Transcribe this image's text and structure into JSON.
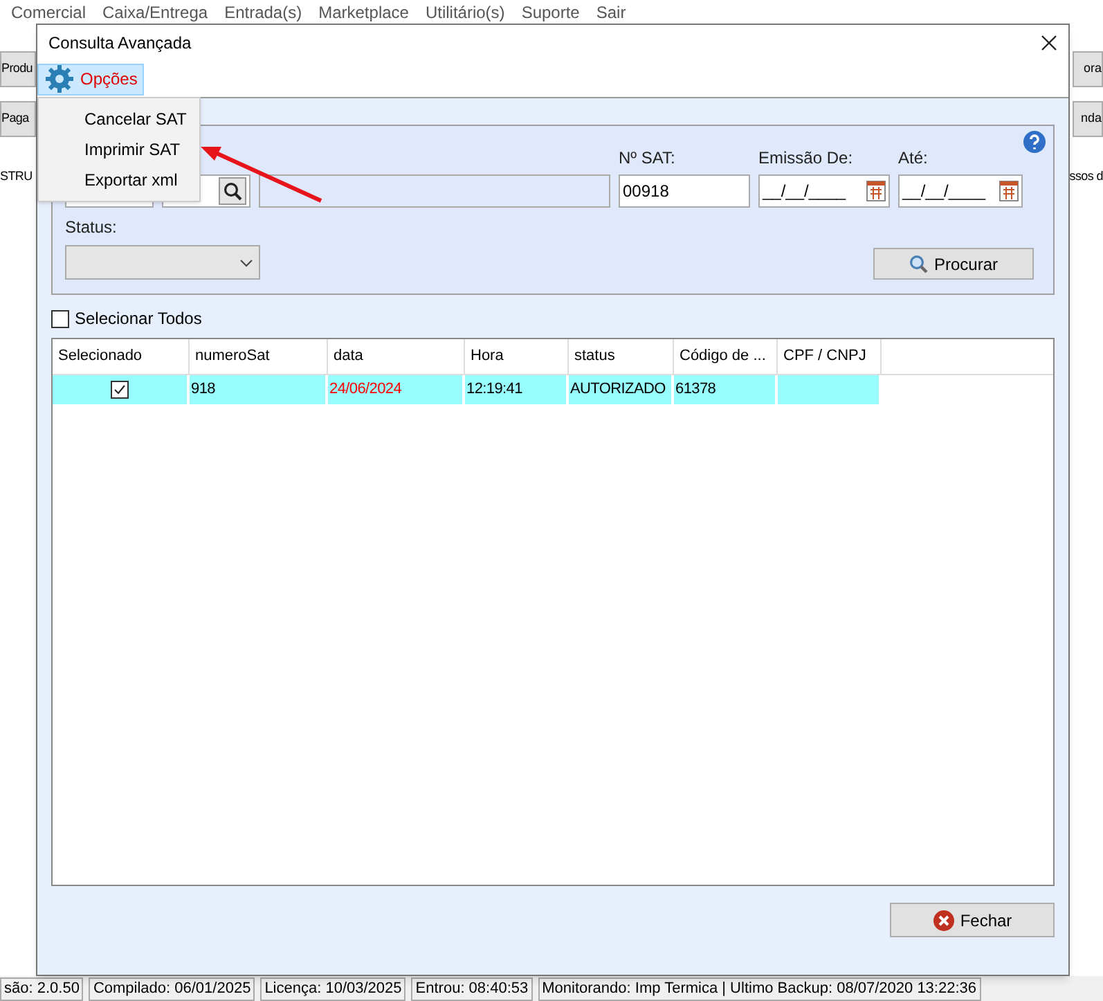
{
  "background_app": {
    "menu": [
      "Comercial",
      "Caixa/Entrega",
      "Entrada(s)",
      "Marketplace",
      "Utilitário(s)",
      "Suporte",
      "Sair"
    ],
    "left_buttons": [
      "Produ",
      "Paga"
    ],
    "left_text": "STRU",
    "right_buttons": [
      "ora",
      "nda"
    ],
    "right_text": "ssos d"
  },
  "dialog": {
    "title": "Consulta Avançada",
    "menu": {
      "label": "Opções",
      "expanded": true,
      "items": [
        "Cancelar SAT",
        "Imprimir SAT",
        "Exportar xml"
      ]
    },
    "filter": {
      "sat_label": "Nº SAT:",
      "sat_value": "00918",
      "emissao_label": "Emissão De:",
      "emissao_value": "__/__/____",
      "ate_label": "Até:",
      "ate_value": "__/__/____",
      "status_label": "Status:",
      "search_button": "Procurar"
    },
    "select_all": {
      "label": "Selecionar Todos",
      "checked": false
    },
    "table": {
      "columns": [
        "Selecionado",
        "numeroSat",
        "data",
        "Hora",
        "status",
        "Código de ...",
        "CPF / CNPJ"
      ],
      "rows": [
        {
          "checked": true,
          "cells": [
            "",
            "918",
            "24/06/2024",
            "12:19:41",
            "AUTORIZADO",
            "61378",
            ""
          ]
        }
      ]
    },
    "close_button": "Fechar"
  },
  "status_bar": [
    "são: 2.0.50",
    "Compilado: 06/01/2025",
    "Licença: 10/03/2025",
    "Entrou: 08:40:53",
    "Monitorando: Imp Termica | Ultimo Backup: 08/07/2020 13:22:36"
  ]
}
